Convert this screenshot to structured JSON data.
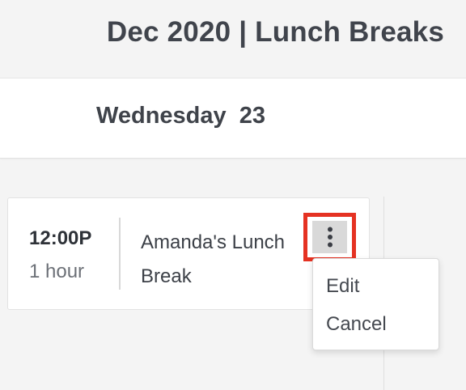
{
  "header": {
    "title": "Dec 2020 | Lunch Breaks"
  },
  "day": {
    "label": "Wednesday  23"
  },
  "event": {
    "time": "12:00P",
    "duration": "1 hour",
    "title": "Amanda's Lunch Break"
  },
  "menu": {
    "trigger_icon": "more-vertical-icon",
    "highlight_color": "#e53222",
    "items": [
      {
        "label": "Edit"
      },
      {
        "label": "Cancel"
      }
    ]
  }
}
